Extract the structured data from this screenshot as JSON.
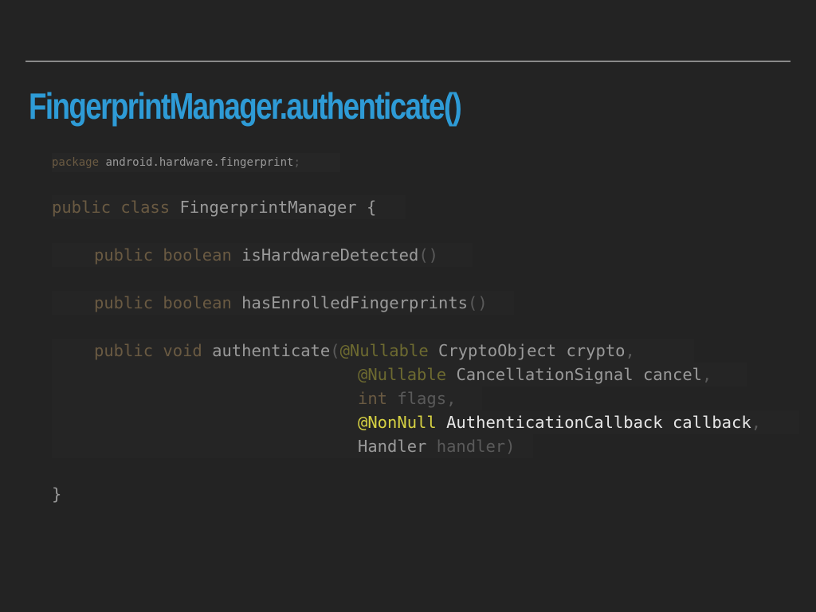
{
  "slide": {
    "title": "FingerprintManager.authenticate()"
  },
  "code": {
    "package_kw": "package",
    "package_name": "android.hardware.fingerprint",
    "package_semicolon": ";",
    "class_line": {
      "kw1": "public",
      "kw2": "class",
      "name": "FingerprintManager",
      "brace": "{"
    },
    "method1": {
      "kw1": "public",
      "kw2": "boolean",
      "name": "isHardwareDetected",
      "parens": "()"
    },
    "method2": {
      "kw1": "public",
      "kw2": "boolean",
      "name": "hasEnrolledFingerprints",
      "parens": "()"
    },
    "method3": {
      "kw1": "public",
      "kw2": "void",
      "name": "authenticate",
      "open_paren": "(",
      "params": [
        {
          "annotation": "@Nullable",
          "type": "CryptoObject",
          "name": "crypto",
          "sep": ","
        },
        {
          "annotation": "@Nullable",
          "type": "CancellationSignal",
          "name": "cancel",
          "sep": ","
        },
        {
          "annotation": "",
          "type": "int",
          "name": "flags",
          "sep": ","
        },
        {
          "annotation": "@NonNull",
          "type": "AuthenticationCallback",
          "name": "callback",
          "sep": ","
        },
        {
          "annotation": "",
          "type": "Handler",
          "name": "handler",
          "sep": ")"
        }
      ]
    },
    "closing_brace": "}"
  },
  "colors": {
    "title": "#2e9bd6",
    "background": "#232323",
    "keyword": "#6a5a42",
    "annotation_highlight": "#d6d143"
  }
}
